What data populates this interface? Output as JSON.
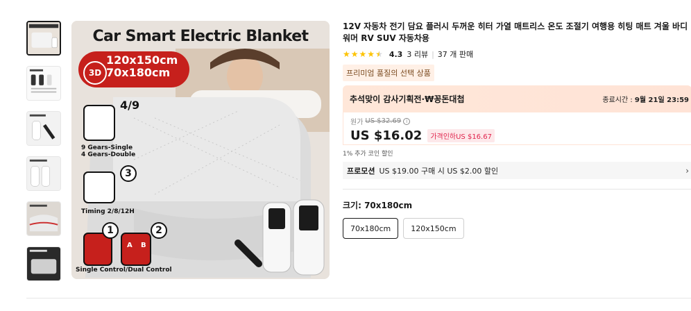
{
  "product": {
    "title": "12V 자동차 전기 담요 플러시 두꺼운 히터 가열 매트리스 온도 조절기 여행용 히팅 매트 겨울 바디 워머 RV SUV 자동차용",
    "rating": "4.3",
    "reviews": "3 리뷰",
    "sold": "37 개 판매",
    "stars": 4.3
  },
  "premium_tag": "프리미엄 품질의 선택 상품",
  "promo_banner": {
    "title": "추석맞이 감사기획전·₩꽁돈대첩",
    "end_label": "종료시간 :",
    "end_time": "9월 21일 23:59"
  },
  "price": {
    "original_label": "원가",
    "original": "US $32.69",
    "info_icon": "i",
    "current": "US $16.02",
    "drop_badge": "가격인하US $16.67"
  },
  "coin_text": "1% 추가 코인 할인",
  "promotion": {
    "label": "프로모션",
    "text": "US $19.00 구매 시 US $2.00 할인",
    "chevron": "›"
  },
  "size": {
    "label": "크기: ",
    "selected": "70x180cm",
    "options": [
      "70x180cm",
      "120x150cm"
    ]
  },
  "main_image": {
    "headline": "Car Smart Electric Blanket",
    "badge_3d": "3D",
    "size_line1": "120x150cm",
    "size_line2": "70x180cm",
    "gear_num": "4/9",
    "gear_text1": "9 Gears-Single",
    "gear_text2": "4 Gears-Double",
    "three": "3",
    "timing": "Timing 2/8/12H",
    "one": "1",
    "two": "2",
    "a": "A",
    "b": "B",
    "control_text": "Single Control/Dual Control"
  },
  "colors": {
    "accent_red": "#e0244d",
    "banner_bg": "#ffe7d9",
    "star": "#fdc300"
  }
}
